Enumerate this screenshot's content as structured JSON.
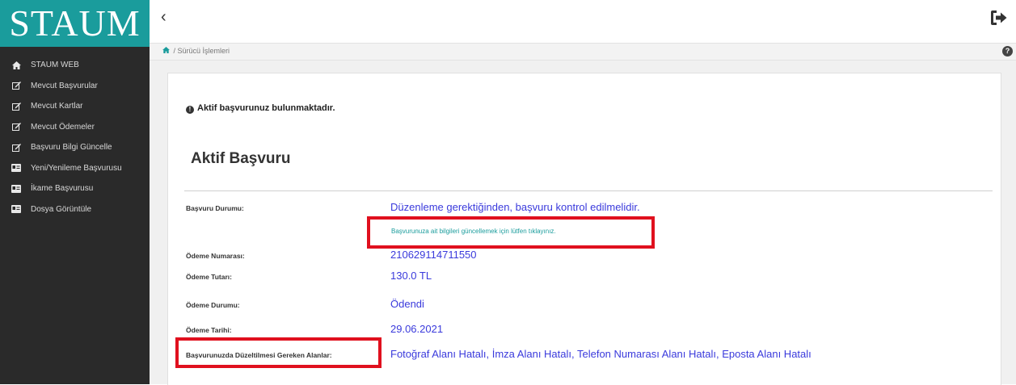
{
  "sidebar": {
    "logo": "STAUM",
    "items": [
      {
        "label": "STAUM WEB",
        "icon": "home-icon"
      },
      {
        "label": "Mevcut Başvurular",
        "icon": "edit-icon"
      },
      {
        "label": "Mevcut Kartlar",
        "icon": "edit-icon"
      },
      {
        "label": "Mevcut Ödemeler",
        "icon": "edit-icon"
      },
      {
        "label": "Başvuru Bilgi Güncelle",
        "icon": "edit-icon"
      },
      {
        "label": "Yeni/Yenileme Başvurusu",
        "icon": "id-card-icon"
      },
      {
        "label": "İkame Başvurusu",
        "icon": "id-card-icon"
      },
      {
        "label": "Dosya Görüntüle",
        "icon": "id-card-icon"
      }
    ]
  },
  "topbar": {
    "back_glyph": "‹",
    "logout_icon": "logout-icon"
  },
  "breadcrumb": {
    "path": "/ Sürücü İşlemleri"
  },
  "main": {
    "info_message": "Aktif başvurunuz bulunmaktadır.",
    "section_title": "Aktif Başvuru",
    "fields": [
      {
        "label": "Başvuru Durumu:",
        "value": "Düzenleme gerektiğinden, başvuru kontrol edilmelidir."
      },
      {
        "label": "Ödeme Numarası:",
        "value": "210629114711550"
      },
      {
        "label": "Ödeme Tutarı:",
        "value": "130.0 TL"
      },
      {
        "label": "Ödeme Durumu:",
        "value": "Ödendi"
      },
      {
        "label": "Ödeme Tarihi:",
        "value": "29.06.2021"
      },
      {
        "label": "Başvurunuzda Düzeltilmesi Gereken Alanlar:",
        "value": "Fotoğraf Alanı Hatalı, İmza Alanı Hatalı, Telefon Numarası Alanı Hatalı, Eposta Alanı Hatalı"
      }
    ],
    "update_link": "Başvurunuza ait bilgileri güncellemek için lütfen tıklayınız."
  },
  "colors": {
    "accent": "#1a9c9c",
    "sidebar_bg": "#2a2a2a",
    "value_text": "#3a3adc",
    "highlight": "#e0101e"
  }
}
